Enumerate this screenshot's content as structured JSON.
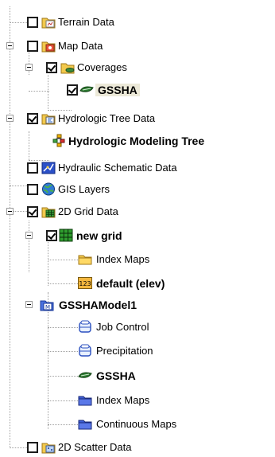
{
  "tree": {
    "terrain_data": {
      "label": "Terrain Data",
      "checked": false
    },
    "map_data": {
      "label": "Map Data",
      "checked": false
    },
    "coverages": {
      "label": "Coverages",
      "checked": true
    },
    "gssha_coverage": {
      "label": "GSSHA",
      "checked": true
    },
    "hydrologic_tree_data": {
      "label": "Hydrologic Tree Data",
      "checked": true
    },
    "hydrologic_modeling_tree": {
      "label": "Hydrologic Modeling Tree"
    },
    "hydraulic_schematic_data": {
      "label": "Hydraulic Schematic Data",
      "checked": false
    },
    "gis_layers": {
      "label": "GIS Layers",
      "checked": false
    },
    "grid_2d_data": {
      "label": "2D Grid Data",
      "checked": true
    },
    "new_grid": {
      "label": "new grid",
      "checked": true
    },
    "index_maps_grid": {
      "label": "Index Maps"
    },
    "default_elev": {
      "label": "default (elev)",
      "icon_text": "123"
    },
    "gssha_model": {
      "label": "GSSHAModel1",
      "icon_text": "M"
    },
    "job_control": {
      "label": "Job Control"
    },
    "precipitation": {
      "label": "Precipitation"
    },
    "gssha_model_item": {
      "label": "GSSHA"
    },
    "index_maps_model": {
      "label": "Index Maps"
    },
    "continuous_maps": {
      "label": "Continuous Maps"
    },
    "scatter_2d_data": {
      "label": "2D Scatter Data",
      "checked": false
    }
  },
  "colors": {
    "folder": "#f2c94c",
    "blue_folder": "#3f5fd6",
    "selection": "#ece9d8"
  }
}
